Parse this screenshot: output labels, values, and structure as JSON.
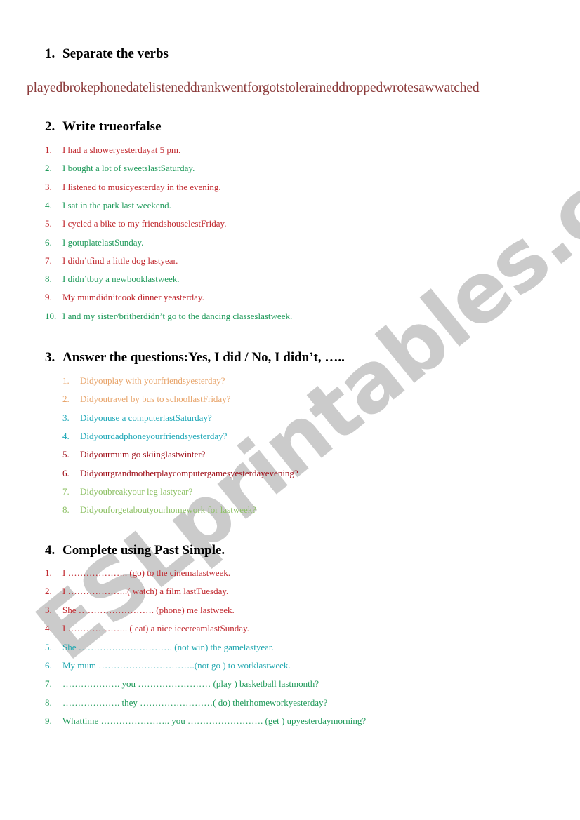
{
  "watermark": "ESLprintables.com",
  "section1": {
    "number": "1.",
    "title": "Separate the verbs",
    "verbs_string": "playedbrokephonedatelisteneddrankwentforgotstoleraineddroppedwrotesawwatched"
  },
  "section2": {
    "number": "2.",
    "title": "Write trueorfalse",
    "items": [
      {
        "n": "1.",
        "text": "I had a showeryesterdayat 5 pm.",
        "color": "#c0272d"
      },
      {
        "n": "2.",
        "text": "I bought a lot of sweetslastSaturday.",
        "color": "#1e9a5a"
      },
      {
        "n": "3.",
        "text": "I listened to musicyesterday in the evening.",
        "color": "#c0272d"
      },
      {
        "n": "4.",
        "text": "I sat in the park last weekend.",
        "color": "#1e9a5a"
      },
      {
        "n": "5.",
        "text": "I cycled a bike to my friendshouselestFriday.",
        "color": "#c0272d"
      },
      {
        "n": "6.",
        "text": "I gotuplatelastSunday.",
        "color": "#1e9a5a"
      },
      {
        "n": "7.",
        "text": "I didn’tfind a little dog lastyear.",
        "color": "#c0272d"
      },
      {
        "n": "8.",
        "text": "I didn’tbuy a newbooklastweek.",
        "color": "#1e9a5a"
      },
      {
        "n": "9.",
        "text": "My mumdidn’tcook dinner yeasterday.",
        "color": "#c0272d"
      },
      {
        "n": "10.",
        "text": "I and my sister/britherdidn’t go to the dancing classeslastweek.",
        "color": "#1e9a5a"
      }
    ]
  },
  "section3": {
    "number": "3.",
    "title": "Answer the questions:Yes, I did / No, I didn’t, …..",
    "items": [
      {
        "n": "1.",
        "text": "Didyouplay with yourfriendsyesterday?",
        "color": "#e8a46a"
      },
      {
        "n": "2.",
        "text": "Didyoutravel by bus to schoollastFriday?",
        "color": "#e8a46a"
      },
      {
        "n": "3.",
        "text": "Didyouuse a computerlastSaturday?",
        "color": "#1fa9b8"
      },
      {
        "n": "4.",
        "text": "Didyourdadphoneyourfriendsyesterday?",
        "color": "#1fa9b8"
      },
      {
        "n": "5.",
        "text": "Didyourmum go skiinglastwinter?",
        "color": "#a0101a"
      },
      {
        "n": "6.",
        "text": "Didyourgrandmotherplaycomputergamesyesterdayevening?",
        "color": "#a0101a"
      },
      {
        "n": "7.",
        "text": "Didyoubreakyour leg lastyear?",
        "color": "#8cc063"
      },
      {
        "n": "8.",
        "text": "Didyouforgetaboutyourhomework for lastweek?",
        "color": "#8cc063"
      }
    ]
  },
  "section4": {
    "number": "4.",
    "title": "Complete using Past Simple.",
    "items": [
      {
        "n": "1.",
        "text": "I ……………….. (go) to the cinemalastweek.",
        "color": "#c0272d"
      },
      {
        "n": "2.",
        "text": "I ………………..( watch) a film lastTuesday.",
        "color": "#c0272d"
      },
      {
        "n": "3.",
        "text": "She ……………………. (phone) me lastweek.",
        "color": "#c0272d"
      },
      {
        "n": "4.",
        "text": "I ……………….. ( eat)  a nice icecreamlastSunday.",
        "color": "#c0272d"
      },
      {
        "n": "5.",
        "text": "She …………………………. (not win) the gamelastyear.",
        "color": "#22a8b0"
      },
      {
        "n": "6.",
        "text": "My mum …………………………..(not go ) to worklastweek.",
        "color": "#22a8b0"
      },
      {
        "n": "7.",
        "text": "………………. you …………………… (play ) basketball lastmonth?",
        "color": "#1f9a5a"
      },
      {
        "n": "8.",
        "text": "………………. they ……………………( do) theirhomeworkyesterday?",
        "color": "#1f9a5a"
      },
      {
        "n": "9.",
        "text": "Whattime ………………….. you ……………………. (get ) upyesterdaymorning?",
        "color": "#1f9a5a"
      }
    ]
  }
}
